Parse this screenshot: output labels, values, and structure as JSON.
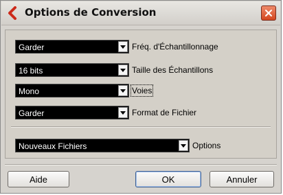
{
  "dialog": {
    "title": "Options de Conversion",
    "close_icon": "close-icon",
    "app_icon": "cubase-logo-icon"
  },
  "settings": [
    {
      "value": "Garder",
      "label": "Fréq. d'Échantillonnage"
    },
    {
      "value": "16 bits",
      "label": "Taille des Échantillons"
    },
    {
      "value": "Mono",
      "label": "Voies"
    },
    {
      "value": "Garder",
      "label": "Format de Fichier"
    }
  ],
  "options": {
    "value": "Nouveaux Fichiers",
    "label": "Options"
  },
  "buttons": {
    "help": "Aide",
    "ok": "OK",
    "cancel": "Annuler"
  },
  "colors": {
    "accent": "#cc2a1a",
    "close_button": "#d4461e",
    "field_bg": "#000000"
  }
}
